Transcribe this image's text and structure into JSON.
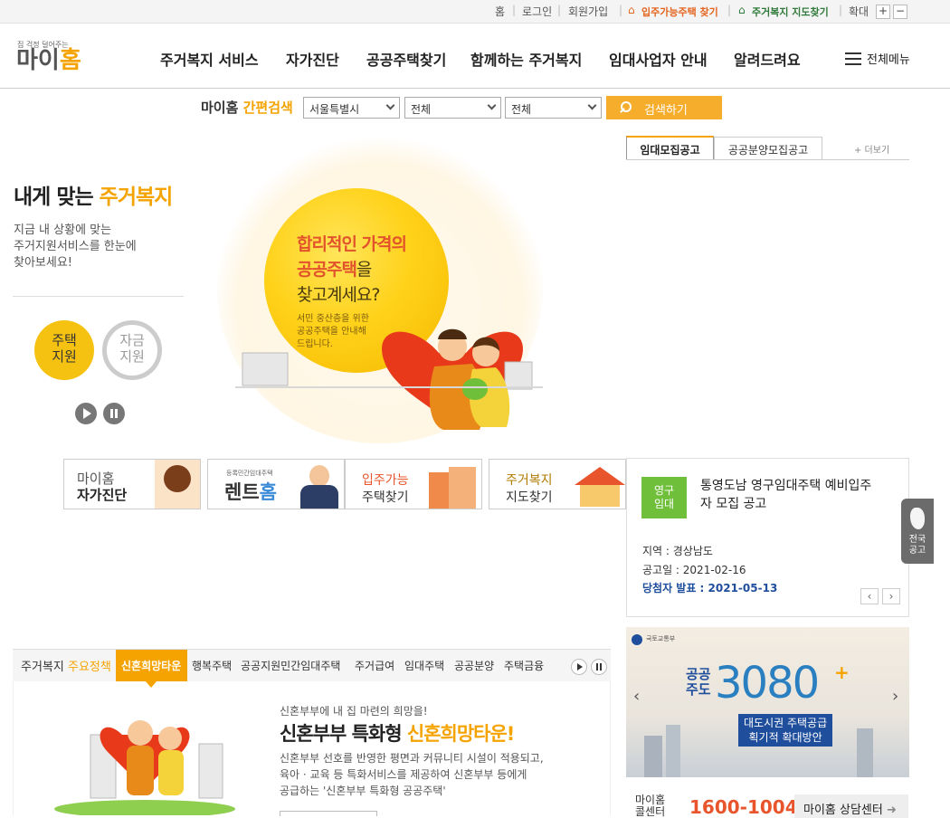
{
  "utility": {
    "home": "홈",
    "login": "로그인",
    "join": "회원가입",
    "find_housing": "입주가능주택 찾기",
    "map_find": "주거복지 지도찾기",
    "zoom": "확대",
    "zoom_in": "+",
    "zoom_out": "−",
    "sep": "|"
  },
  "logo": {
    "tagline": "집 걱정 덜어주는",
    "name_a": "마이",
    "name_b": "홈"
  },
  "nav": {
    "items": [
      "주거복지 서비스",
      "자가진단",
      "공공주택찾기",
      "함께하는 주거복지",
      "임대사업자 안내",
      "알려드려요"
    ],
    "all_menu": "전체메뉴"
  },
  "quick_search": {
    "label_a": "마이홈 ",
    "label_b": "간편검색",
    "region": "서울특별시",
    "type": "전체",
    "category": "전체",
    "button": "검색하기"
  },
  "left": {
    "title_a": "내게 맞는 ",
    "title_b": "주거복지",
    "desc": [
      "지금 내 상황에 맞는",
      "주거지원서비스를 한눈에",
      "찾아보세요!"
    ],
    "circle_housing": [
      "주택",
      "지원"
    ],
    "circle_fund": [
      "자금",
      "지원"
    ]
  },
  "hero": {
    "line1": "합리적인 가격의",
    "line2a": "공공주택",
    "line2b": "을",
    "line3": "찾고계세요?",
    "sub": [
      "서민 중산층을 위한",
      "공공주택을 안내해",
      "드립니다."
    ]
  },
  "cards": {
    "self_a": "마이홈",
    "self_b": "자가진단",
    "renthome_small": "등록민간임대주택",
    "renthome_a": "렌트",
    "renthome_b": "홈",
    "find_a": "입주가능",
    "find_b": "주택찾기",
    "map_a": "주거복지",
    "map_b": "지도찾기"
  },
  "notice": {
    "tab_rent": "임대모집공고",
    "tab_sale": "공공분양모집공고",
    "more": "+ 더보기",
    "badge": [
      "영구",
      "임대"
    ],
    "title": [
      "통영도남 영구임대주택 예비입주",
      "자 모집 공고"
    ],
    "region": "지역 : 경상남도",
    "date": "공고일 : 2021-02-16",
    "announce": "당첨자 발표 : 2021-05-13",
    "side": [
      "전국",
      "공고"
    ]
  },
  "banner": {
    "ministry": "국토교통부",
    "public": [
      "공공",
      "주도"
    ],
    "num": "3080",
    "plus": "+",
    "sub": [
      "대도시권 주택공급",
      "획기적 확대방안"
    ]
  },
  "policy": {
    "label_a": "주거복지 ",
    "label_b": "주요정책",
    "tabs": [
      "신혼희망타운",
      "행복주택",
      "공공지원민간임대주택",
      "주거급여",
      "임대주택",
      "공공분양",
      "주택금융"
    ],
    "small": "신혼부부에 내 집 마련의 희망을!",
    "heading_a": "신혼부부 특화형 ",
    "heading_b": "신혼희망타운!",
    "desc": [
      "신혼부부 선호를 반영한 평면과 커뮤니티 시설이 적용되고,",
      "육아 · 교육 등 특화서비스를 제공하여 신혼부부 등에게",
      "공급하는 '신혼부부 특화형 공공주택'"
    ]
  },
  "center": {
    "label": [
      "마이홈",
      "콜센터"
    ],
    "phone": "1600-1004",
    "button": "마이홈 상담센터"
  },
  "colors": {
    "accent": "#f5a300",
    "green": "#6fbf3a",
    "navy": "#1f4e9c"
  }
}
